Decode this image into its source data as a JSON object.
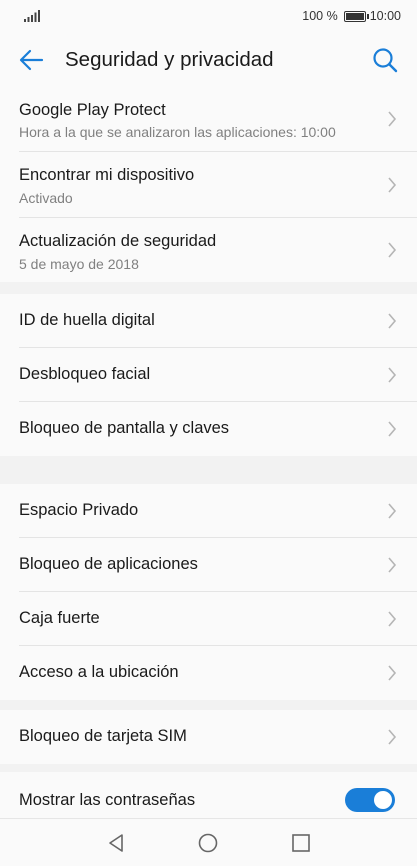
{
  "status": {
    "battery": "100 %",
    "time": "10:00"
  },
  "header": {
    "title": "Seguridad y privacidad"
  },
  "section1": [
    {
      "label": "Google Play Protect",
      "sub": "Hora a la que se analizaron las aplicaciones: 10:00"
    },
    {
      "label": "Encontrar mi dispositivo",
      "sub": "Activado"
    },
    {
      "label": "Actualización de seguridad",
      "sub": "5 de mayo de 2018"
    }
  ],
  "section2": [
    {
      "label": "ID de huella digital"
    },
    {
      "label": "Desbloqueo facial"
    },
    {
      "label": "Bloqueo de pantalla y claves"
    }
  ],
  "section3": [
    {
      "label": "Espacio Privado"
    },
    {
      "label": "Bloqueo de aplicaciones"
    },
    {
      "label": "Caja fuerte"
    },
    {
      "label": "Acceso a la ubicación"
    }
  ],
  "section4": [
    {
      "label": "Bloqueo de tarjeta SIM"
    }
  ],
  "section5": [
    {
      "label": "Mostrar las contraseñas",
      "toggle_on": true
    }
  ],
  "colors": {
    "accent": "#1a7ed8",
    "background": "#f2f2f2",
    "surface": "#fafafa"
  },
  "icons": {
    "back": "arrow-left-icon",
    "search": "search-icon",
    "chevron": "chevron-right-icon",
    "nav_back": "triangle-back-icon",
    "nav_home": "circle-home-icon",
    "nav_recent": "square-recent-icon"
  }
}
